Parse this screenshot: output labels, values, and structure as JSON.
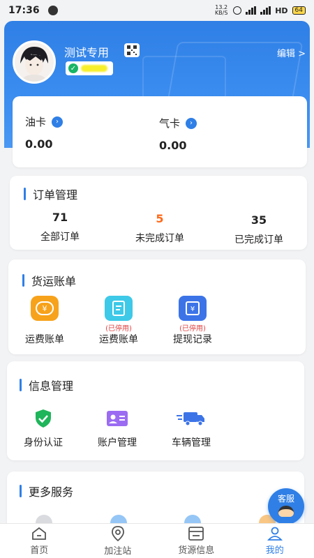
{
  "status": {
    "time": "17:36",
    "net_speed": "13.2 KB/S",
    "network": "HD",
    "battery": "64"
  },
  "profile": {
    "username": "测试专用",
    "edit_label": "编辑"
  },
  "balance": {
    "oil": {
      "label": "油卡",
      "value": "0.00"
    },
    "gas": {
      "label": "气卡",
      "value": "0.00"
    }
  },
  "orders": {
    "title": "订单管理",
    "items": [
      {
        "count": "71",
        "label": "全部订单"
      },
      {
        "count": "5",
        "label": "未完成订单"
      },
      {
        "count": "35",
        "label": "已完成订单"
      }
    ]
  },
  "freight": {
    "title": "货运账单",
    "items": [
      {
        "tag": "",
        "label": "运费账单",
        "icon": "yen-bill-icon",
        "color": "#f7a21b"
      },
      {
        "tag": "(已停用)",
        "label": "运费账单",
        "icon": "bill-list-icon",
        "color": "#3ec9e8"
      },
      {
        "tag": "(已停用)",
        "label": "提现记录",
        "icon": "withdraw-record-icon",
        "color": "#3c74e8"
      }
    ]
  },
  "info": {
    "title": "信息管理",
    "items": [
      {
        "label": "身份认证",
        "icon": "shield-check-icon"
      },
      {
        "label": "账户管理",
        "icon": "id-card-icon"
      },
      {
        "label": "车辆管理",
        "icon": "truck-icon"
      }
    ]
  },
  "more": {
    "title": "更多服务"
  },
  "customer_service": {
    "label": "客服"
  },
  "tabs": [
    {
      "label": "首页",
      "icon": "home-icon"
    },
    {
      "label": "加注站",
      "icon": "location-pin-icon"
    },
    {
      "label": "货源信息",
      "icon": "cargo-list-icon"
    },
    {
      "label": "我的",
      "icon": "user-icon"
    }
  ],
  "colors": {
    "primary": "#2f7fe6",
    "accent_orange": "#ff6a1a",
    "disabled_tag": "#e04040"
  }
}
